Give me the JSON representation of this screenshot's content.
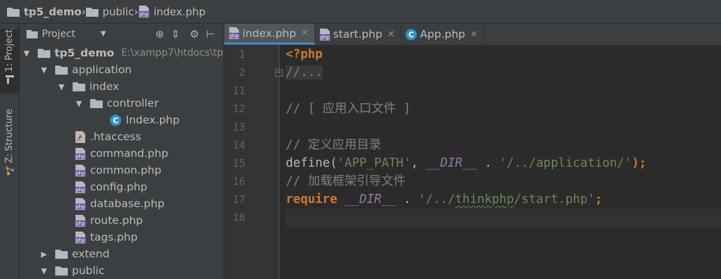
{
  "breadcrumb": [
    "tp5_demo",
    "public",
    "index.php"
  ],
  "toolwindows": {
    "project": "1: Project",
    "structure": "Z: Structure"
  },
  "project_panel": {
    "view_label": "Project",
    "tree": [
      {
        "label": "tp5_demo",
        "path": "E:\\xampp7\\htdocs\\tp",
        "kind": "root",
        "expanded": true
      },
      {
        "label": "application",
        "kind": "folder",
        "expanded": true
      },
      {
        "label": "index",
        "kind": "folder",
        "expanded": true
      },
      {
        "label": "controller",
        "kind": "folder",
        "expanded": true
      },
      {
        "label": "Index.php",
        "kind": "class"
      },
      {
        "label": ".htaccess",
        "kind": "htaccess"
      },
      {
        "label": "command.php",
        "kind": "php"
      },
      {
        "label": "common.php",
        "kind": "php"
      },
      {
        "label": "config.php",
        "kind": "php"
      },
      {
        "label": "database.php",
        "kind": "php"
      },
      {
        "label": "route.php",
        "kind": "php"
      },
      {
        "label": "tags.php",
        "kind": "php"
      },
      {
        "label": "extend",
        "kind": "folder",
        "expanded": false
      },
      {
        "label": "public",
        "kind": "folder",
        "expanded": true
      }
    ]
  },
  "editor": {
    "tabs": [
      {
        "label": "index.php",
        "active": true,
        "icon": "php-file-icon"
      },
      {
        "label": "start.php",
        "active": false,
        "icon": "php-file-icon"
      },
      {
        "label": "App.php",
        "active": false,
        "icon": "class-icon"
      }
    ],
    "line_numbers": [
      "1",
      "2",
      "11",
      "12",
      "13",
      "14",
      "15",
      "16",
      "17",
      "18"
    ],
    "code": {
      "open_tag": "<?php",
      "fold": "//...",
      "c12": "// [ 应用入口文件 ]",
      "c14": "// 定义应用目录",
      "define": "define(",
      "app_path": "'APP_PATH'",
      "comma": ", ",
      "dir1": "__DIR__",
      "concat1": " . ",
      "app_dir": "'/../application/'",
      "end1": ");",
      "c16": "// 加载框架引导文件",
      "require": "require",
      "space": " ",
      "dir2": "__DIR__",
      "concat2": " . ",
      "req_q1": "'/../",
      "req_think": "thinkphp",
      "req_q2": "/start.php'",
      "end2": ";"
    }
  },
  "colors": {
    "keyword": "#cc7832",
    "string": "#6a8759",
    "comment": "#808080",
    "magic": "#9876aa",
    "text": "#a9b7c6",
    "tab_accent": "#4a88c7"
  }
}
